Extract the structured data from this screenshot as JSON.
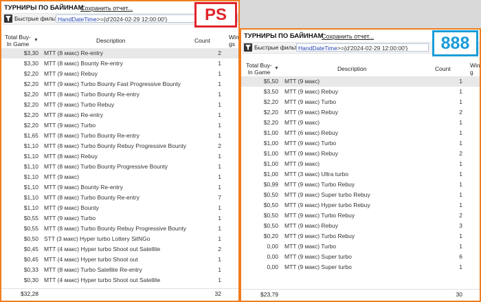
{
  "colors": {
    "frame": "#f07d1e",
    "ps_badge": "#e0242b",
    "badge_888": "#1a9cd8",
    "selected_row": "#e8e8e8"
  },
  "ps": {
    "title": "ТУРНИРЫ ПО БАЙИНАМ",
    "save_label": "Сохранить отчет...",
    "filter_label": "Быстрые фильт",
    "filter_key": "HandDateTime",
    "filter_rest": ">={d'2024-02-29 12:00:00'}",
    "badge": "PS",
    "columns": {
      "buyin": "Total Buy-In Game",
      "desc": "Description",
      "count": "Count",
      "win": "Winn gs"
    },
    "rows": [
      {
        "buyin": "$3,30",
        "desc": "MTT (8 макс) Re-entry",
        "count": "2"
      },
      {
        "buyin": "$3,30",
        "desc": "MTT (8 макс) Bounty Re-entry",
        "count": "1"
      },
      {
        "buyin": "$2,20",
        "desc": "MTT (9 макс) Rebuy",
        "count": "1"
      },
      {
        "buyin": "$2,20",
        "desc": "MTT (9 макс) Turbo Bounty Fast Progressive Bounty",
        "count": "1"
      },
      {
        "buyin": "$2,20",
        "desc": "MTT (8 макс) Turbo Bounty Re-entry",
        "count": "1"
      },
      {
        "buyin": "$2,20",
        "desc": "MTT (9 макс) Turbo Rebuy",
        "count": "1"
      },
      {
        "buyin": "$2,20",
        "desc": "MTT (8 макс) Re-entry",
        "count": "1"
      },
      {
        "buyin": "$2,20",
        "desc": "MTT (9 макс) Turbo",
        "count": "1"
      },
      {
        "buyin": "$1,65",
        "desc": "MTT (8 макс) Turbo Bounty Re-entry",
        "count": "1"
      },
      {
        "buyin": "$1,10",
        "desc": "MTT (8 макс) Turbo Bounty Rebuy Progressive Bounty",
        "count": "2"
      },
      {
        "buyin": "$1,10",
        "desc": "MTT (8 макс) Rebuy",
        "count": "1"
      },
      {
        "buyin": "$1,10",
        "desc": "MTT (8 макс) Turbo Bounty Progressive Bounty",
        "count": "1"
      },
      {
        "buyin": "$1,10",
        "desc": "MTT (9 макс)",
        "count": "1"
      },
      {
        "buyin": "$1,10",
        "desc": "MTT (9 макс) Bounty Re-entry",
        "count": "1"
      },
      {
        "buyin": "$1,10",
        "desc": "MTT (8 макс) Turbo Bounty Re-entry",
        "count": "7"
      },
      {
        "buyin": "$1,10",
        "desc": "MTT (9 макс) Bounty",
        "count": "1"
      },
      {
        "buyin": "$0,55",
        "desc": "MTT (9 макс) Turbo",
        "count": "1"
      },
      {
        "buyin": "$0,55",
        "desc": "MTT (8 макс) Turbo Bounty Rebuy Progressive Bounty",
        "count": "1"
      },
      {
        "buyin": "$0,50",
        "desc": "STT (3 макс) Hyper turbo Lottery SitNGo",
        "count": "1"
      },
      {
        "buyin": "$0,45",
        "desc": "MTT (4 макс) Hyper turbo Shoot out Satellite",
        "count": "2"
      },
      {
        "buyin": "$0,45",
        "desc": "MTT (4 макс) Hyper turbo Shoot out",
        "count": "1"
      },
      {
        "buyin": "$0,33",
        "desc": "MTT (8 макс) Turbo Satellite Re-entry",
        "count": "1"
      },
      {
        "buyin": "$0,30",
        "desc": "MTT (4 макс) Hyper turbo Shoot out Satellite",
        "count": "1"
      }
    ],
    "total": {
      "buyin": "$32,28",
      "count": "32"
    }
  },
  "e888": {
    "title": "ТУРНИРЫ ПО БАЙИНАМ",
    "save_label": "Сохранить отчет...",
    "filter_label": "Быстрые фильт",
    "filter_key": "HandDateTime",
    "filter_rest": ">={d'2024-02-29 12:00:00'}",
    "badge": "888",
    "columns": {
      "buyin": "Total Buy-In Game",
      "desc": "Description",
      "count": "Count",
      "win": "Winn g"
    },
    "rows": [
      {
        "buyin": "$5,50",
        "desc": "MTT (9 макс)",
        "count": "1"
      },
      {
        "buyin": "$3,50",
        "desc": "MTT (9 макс) Rebuy",
        "count": "1"
      },
      {
        "buyin": "$2,20",
        "desc": "MTT (9 макс) Turbo",
        "count": "1"
      },
      {
        "buyin": "$2,20",
        "desc": "MTT (9 макс) Rebuy",
        "count": "2"
      },
      {
        "buyin": "$2,20",
        "desc": "MTT (9 макс)",
        "count": "1"
      },
      {
        "buyin": "$1,00",
        "desc": "MTT (6 макс) Rebuy",
        "count": "1"
      },
      {
        "buyin": "$1,00",
        "desc": "MTT (9 макс) Turbo",
        "count": "1"
      },
      {
        "buyin": "$1,00",
        "desc": "MTT (9 макс) Rebuy",
        "count": "2"
      },
      {
        "buyin": "$1,00",
        "desc": "MTT (9 макс)",
        "count": "1"
      },
      {
        "buyin": "$1,00",
        "desc": "MTT (3 макс) Ultra turbo",
        "count": "1"
      },
      {
        "buyin": "$0,99",
        "desc": "MTT (9 макс) Turbo Rebuy",
        "count": "1"
      },
      {
        "buyin": "$0,50",
        "desc": "MTT (9 макс) Super turbo Rebuy",
        "count": "1"
      },
      {
        "buyin": "$0,50",
        "desc": "MTT (9 макс) Hyper turbo Rebuy",
        "count": "1"
      },
      {
        "buyin": "$0,50",
        "desc": "MTT (9 макс) Turbo Rebuy",
        "count": "2"
      },
      {
        "buyin": "$0,50",
        "desc": "MTT (9 макс) Rebuy",
        "count": "3"
      },
      {
        "buyin": "$0,20",
        "desc": "MTT (9 макс) Turbo Rebuy",
        "count": "1"
      },
      {
        "buyin": "0,00",
        "desc": "MTT (9 макс) Turbo",
        "count": "1"
      },
      {
        "buyin": "0,00",
        "desc": "MTT (9 макс) Super turbo",
        "count": "6"
      },
      {
        "buyin": "0,00",
        "desc": "MTT (9 макс) Super turbo",
        "count": "1"
      }
    ],
    "total": {
      "buyin": "$23,79",
      "count": "30"
    }
  }
}
